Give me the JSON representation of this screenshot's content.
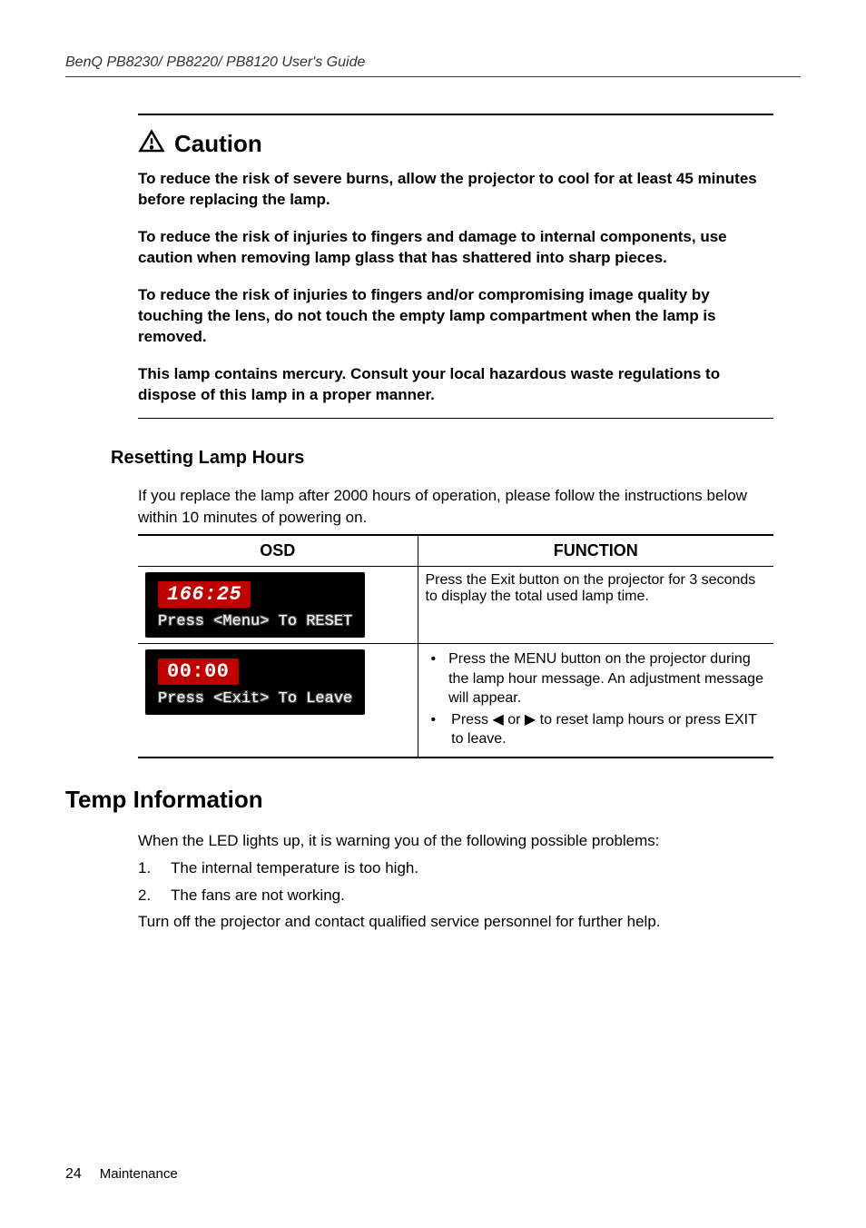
{
  "header": {
    "running_title": "BenQ PB8230/ PB8220/ PB8120 User's Guide"
  },
  "caution": {
    "heading": "Caution",
    "icon": "warning-triangle-icon",
    "paras": [
      "To reduce the risk of severe burns, allow the projector to cool for at least 45 minutes before replacing the lamp.",
      "To reduce the risk of injuries to fingers and damage to internal components, use caution when removing lamp glass that has shattered into sharp pieces.",
      "To reduce the risk of injuries to fingers and/or compromising image quality by touching the lens, do not touch the empty lamp compartment when the lamp is removed.",
      "This lamp contains mercury. Consult your local hazardous waste regulations to dispose of this lamp in a proper manner."
    ]
  },
  "reset_section": {
    "heading": "Resetting Lamp Hours",
    "intro": "If you replace the lamp after 2000 hours of operation, please follow the instructions below within 10 minutes of powering on."
  },
  "table": {
    "headers": {
      "col1": "OSD",
      "col2": "FUNCTION"
    },
    "rows": [
      {
        "osd": {
          "time": "166:25",
          "hint": "Press <Menu>  To RESET"
        },
        "fn_plain": "Press the Exit button on the projector for 3 seconds to display the total used lamp time."
      },
      {
        "osd": {
          "time": "00:00",
          "hint": "Press <Exit>  To Leave"
        },
        "fn_bullets": [
          "Press the MENU button on the projector during the lamp hour message. An adjustment message will appear.",
          "Press ◀ or ▶ to reset lamp hours or press EXIT to leave."
        ]
      }
    ]
  },
  "temp_section": {
    "heading": "Temp Information",
    "intro": "When the LED lights up, it is warning you of the following possible problems:",
    "items": [
      "The internal temperature is too high.",
      "The fans are not working."
    ],
    "outro": "Turn off the projector and contact qualified service personnel for further help."
  },
  "footer": {
    "page_number": "24",
    "section": "Maintenance"
  }
}
